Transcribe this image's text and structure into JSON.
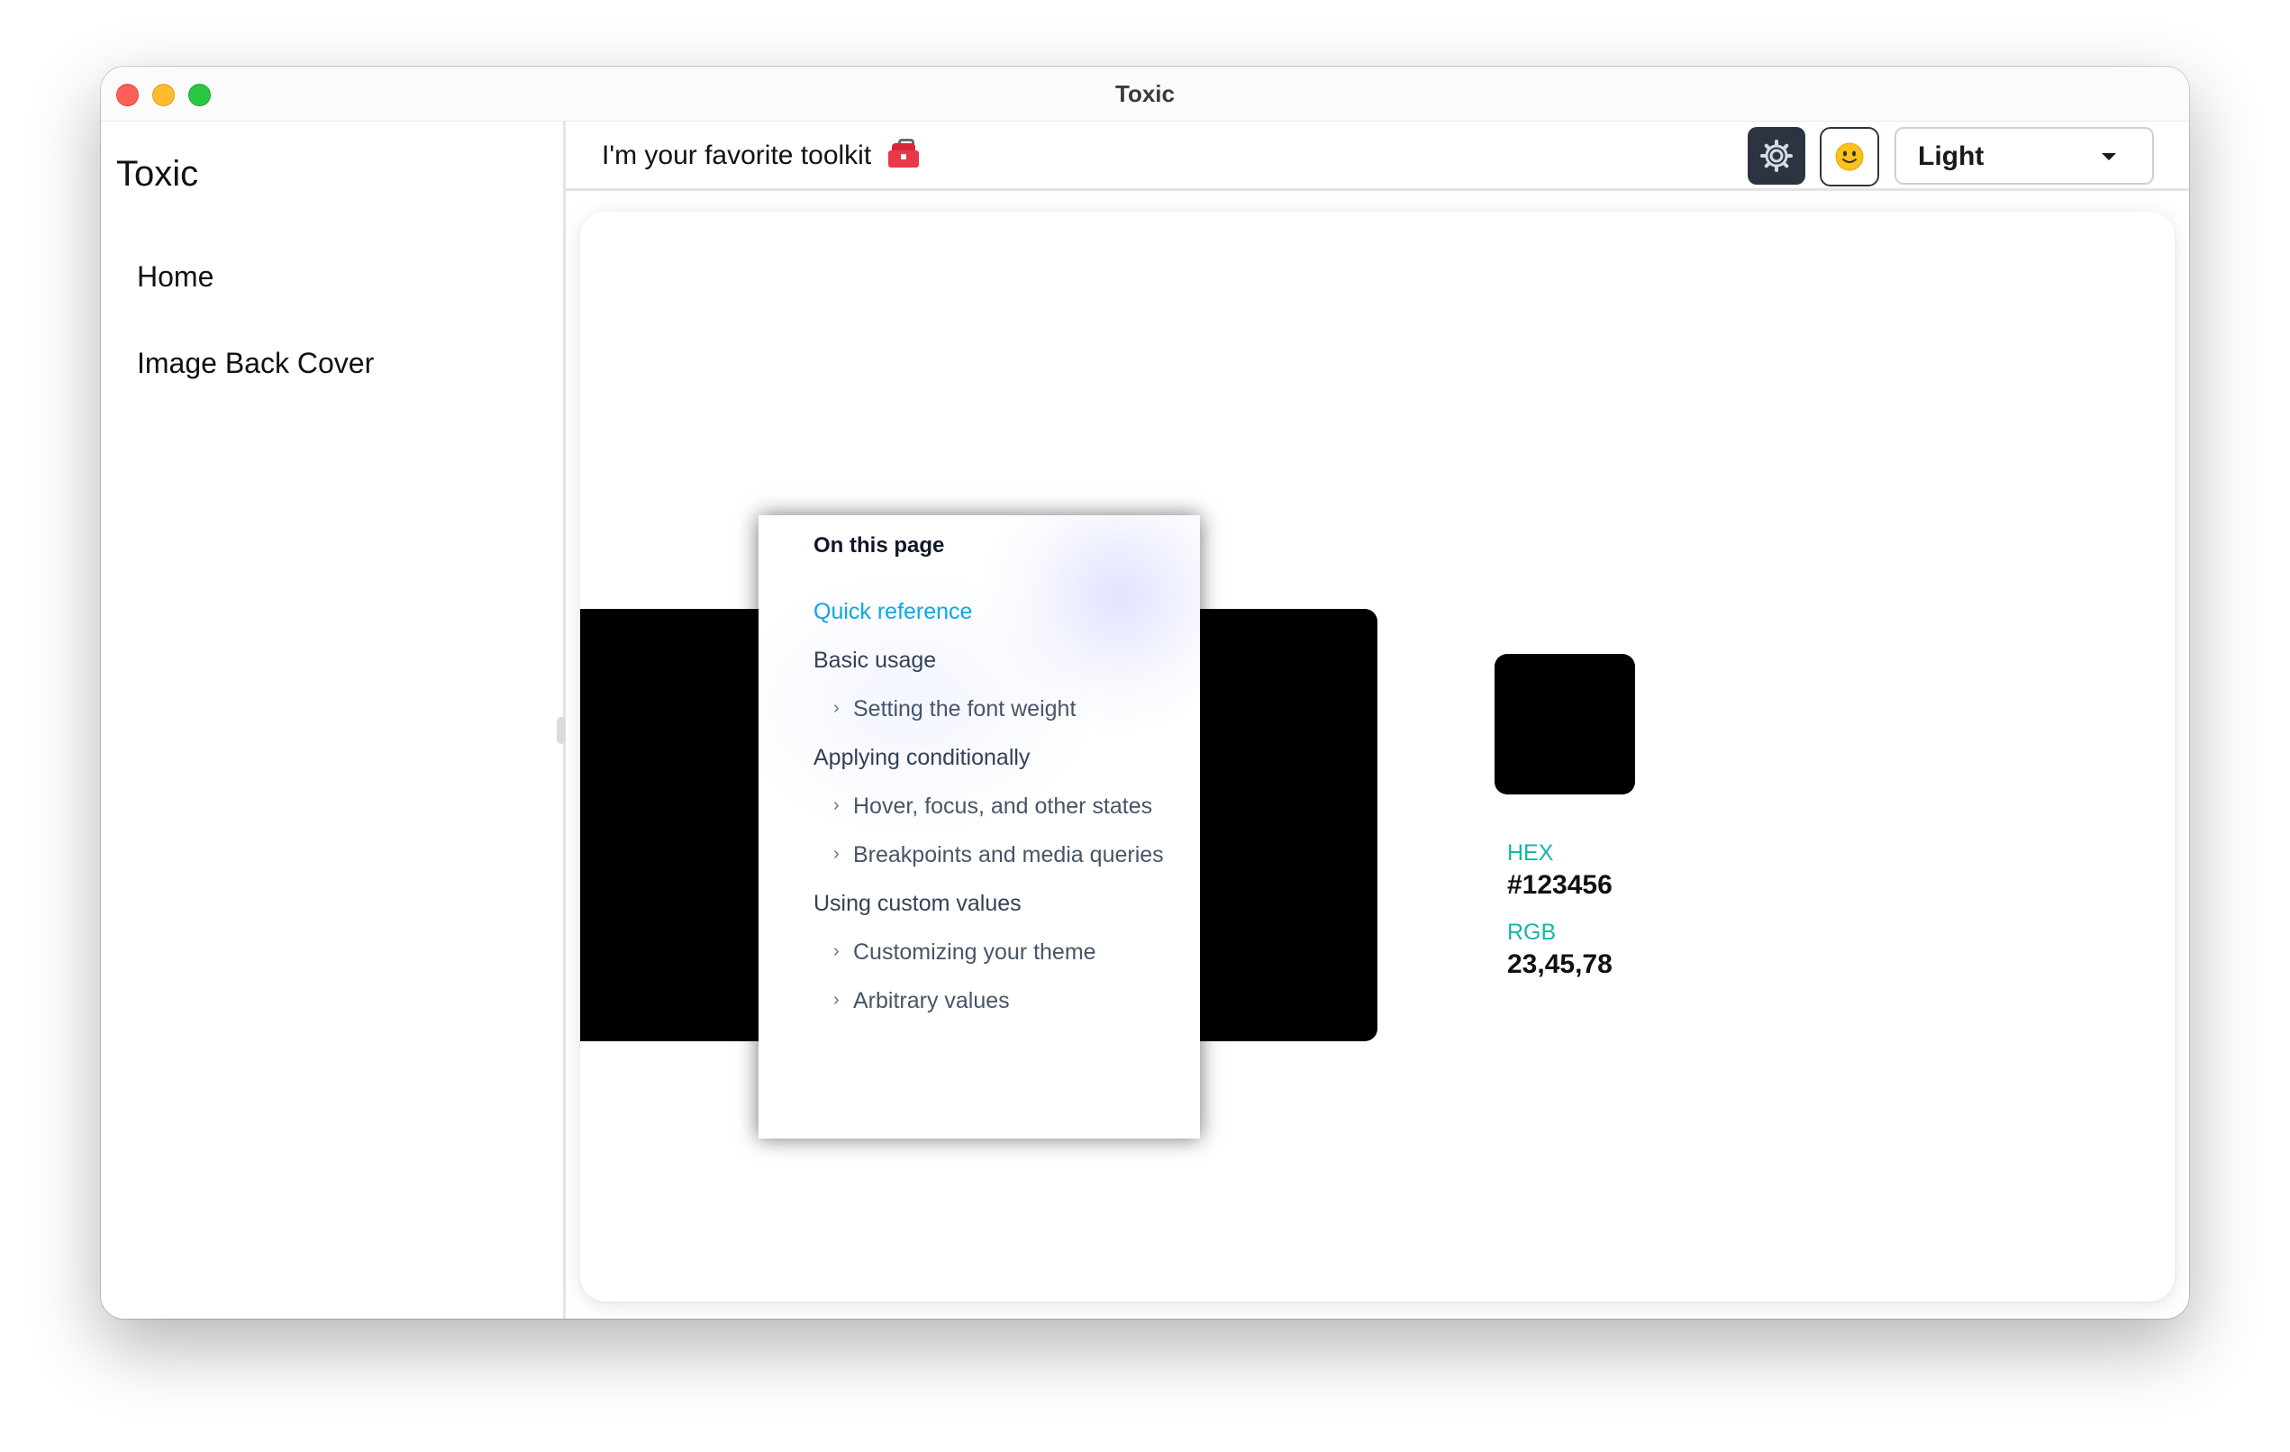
{
  "window": {
    "title": "Toxic"
  },
  "sidebar": {
    "title": "Toxic",
    "items": [
      {
        "label": "Home"
      },
      {
        "label": "Image Back Cover"
      }
    ]
  },
  "header": {
    "tagline": "I'm your favorite toolkit",
    "tagline_icon": "toolbox-icon",
    "settings_icon": "gear-icon",
    "emoji_icon": "smiley-icon",
    "theme_select": {
      "value": "Light"
    }
  },
  "toc": {
    "title": "On this page",
    "links": [
      {
        "label": "Quick reference",
        "level": 1,
        "active": true
      },
      {
        "label": "Basic usage",
        "level": 1
      },
      {
        "label": "Setting the font weight",
        "level": 2
      },
      {
        "label": "Applying conditionally",
        "level": 1
      },
      {
        "label": "Hover, focus, and other states",
        "level": 2
      },
      {
        "label": "Breakpoints and media queries",
        "level": 2
      },
      {
        "label": "Using custom values",
        "level": 1
      },
      {
        "label": "Customizing your theme",
        "level": 2
      },
      {
        "label": "Arbitrary values",
        "level": 2
      }
    ]
  },
  "color_info": {
    "hex_label": "HEX",
    "hex_value": "#123456",
    "rgb_label": "RGB",
    "rgb_value": "23,45,78"
  },
  "colors": {
    "accent_link": "#0ea5e9",
    "label_teal": "#14b8a6",
    "dark_button": "#2c3441",
    "swatch": "#000000"
  }
}
